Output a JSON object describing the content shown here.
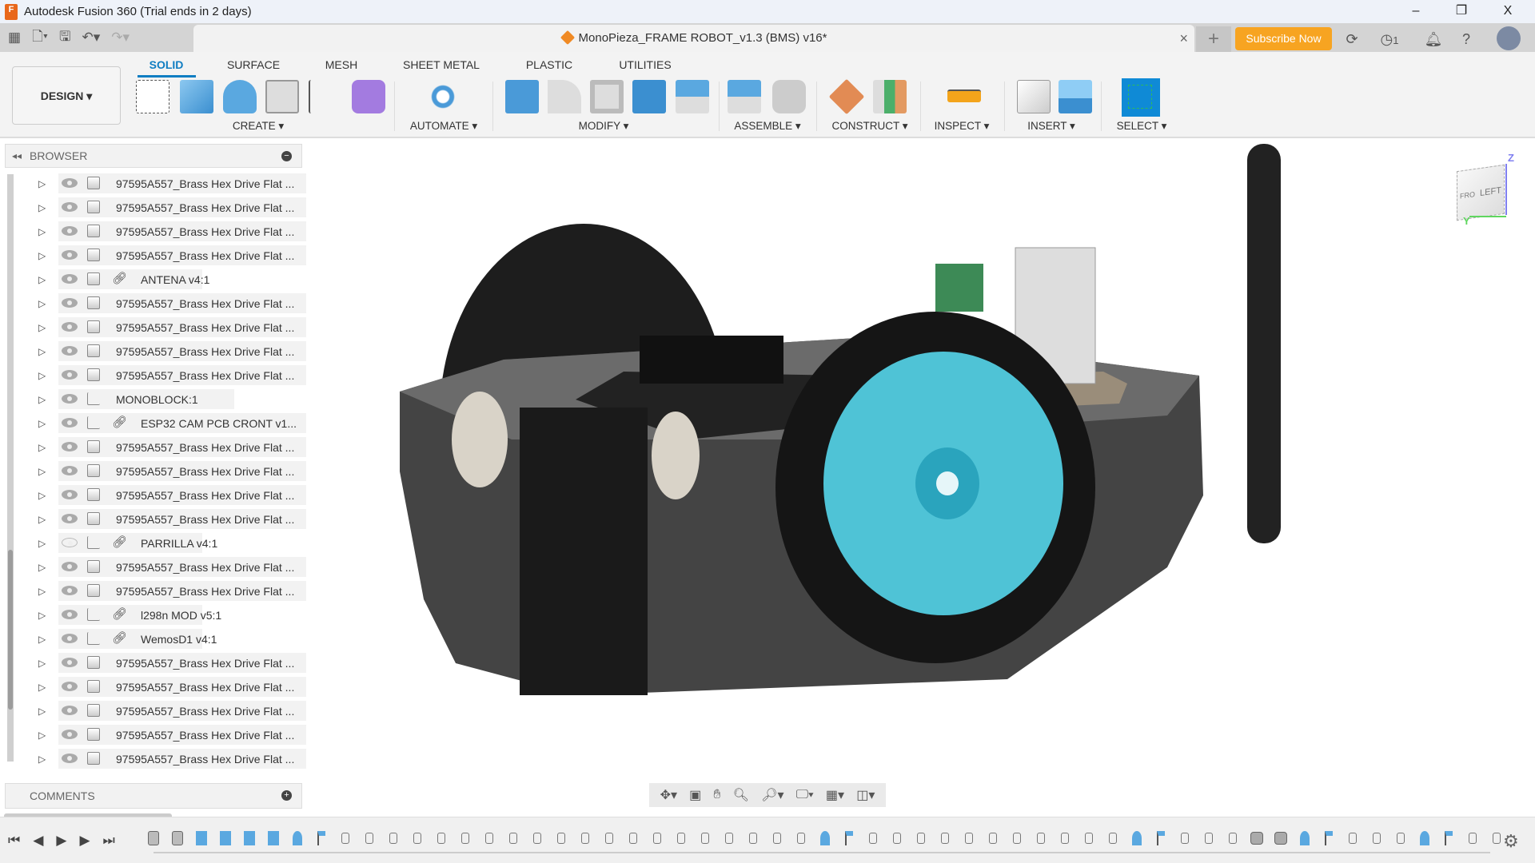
{
  "app": {
    "title": "Autodesk Fusion 360 (Trial ends in 2 days)",
    "icon": "fusion-logo-icon"
  },
  "window": {
    "minimize": "–",
    "restore": "❐",
    "close": "X"
  },
  "document": {
    "title": "MonoPieza_FRAME ROBOT_v1.3 (BMS) v16*",
    "close": "×",
    "new_tab": "+"
  },
  "header": {
    "subscribe": "Subscribe Now",
    "jobs_count": "1"
  },
  "workspace": {
    "label": "DESIGN ▾"
  },
  "tabs": [
    {
      "label": "SOLID"
    },
    {
      "label": "SURFACE"
    },
    {
      "label": "MESH"
    },
    {
      "label": "SHEET METAL"
    },
    {
      "label": "PLASTIC"
    },
    {
      "label": "UTILITIES"
    }
  ],
  "groups": {
    "create": "CREATE ▾",
    "automate": "AUTOMATE ▾",
    "modify": "MODIFY ▾",
    "assemble": "ASSEMBLE ▾",
    "construct": "CONSTRUCT ▾",
    "inspect": "INSPECT ▾",
    "insert": "INSERT ▾",
    "select": "SELECT ▾"
  },
  "colors": {
    "accent": "#0f7dc2",
    "subscribe": "#f7a421",
    "model_wheel": "#4fc3d6"
  },
  "browser": {
    "title": "BROWSER",
    "items": [
      {
        "label": "97595A557_Brass Hex Drive Flat ...",
        "type": "body",
        "visible": true,
        "link": false
      },
      {
        "label": "97595A557_Brass Hex Drive Flat ...",
        "type": "body",
        "visible": true,
        "link": false
      },
      {
        "label": "97595A557_Brass Hex Drive Flat ...",
        "type": "body",
        "visible": true,
        "link": false
      },
      {
        "label": "97595A557_Brass Hex Drive Flat ...",
        "type": "body",
        "visible": true,
        "link": false
      },
      {
        "label": "ANTENA v4:1",
        "type": "body",
        "visible": true,
        "link": true
      },
      {
        "label": "97595A557_Brass Hex Drive Flat ...",
        "type": "body",
        "visible": true,
        "link": false
      },
      {
        "label": "97595A557_Brass Hex Drive Flat ...",
        "type": "body",
        "visible": true,
        "link": false
      },
      {
        "label": "97595A557_Brass Hex Drive Flat ...",
        "type": "body",
        "visible": true,
        "link": false
      },
      {
        "label": "97595A557_Brass Hex Drive Flat ...",
        "type": "body",
        "visible": true,
        "link": false
      },
      {
        "label": "MONOBLOCK:1",
        "type": "assembly",
        "visible": true,
        "link": false
      },
      {
        "label": "ESP32 CAM PCB CRONT v1...",
        "type": "assembly",
        "visible": true,
        "link": true
      },
      {
        "label": "97595A557_Brass Hex Drive Flat ...",
        "type": "body",
        "visible": true,
        "link": false
      },
      {
        "label": "97595A557_Brass Hex Drive Flat ...",
        "type": "body",
        "visible": true,
        "link": false
      },
      {
        "label": "97595A557_Brass Hex Drive Flat ...",
        "type": "body",
        "visible": true,
        "link": false
      },
      {
        "label": "97595A557_Brass Hex Drive Flat ...",
        "type": "body",
        "visible": true,
        "link": false
      },
      {
        "label": "PARRILLA v4:1",
        "type": "assembly",
        "visible": false,
        "link": true
      },
      {
        "label": "97595A557_Brass Hex Drive Flat ...",
        "type": "body",
        "visible": true,
        "link": false
      },
      {
        "label": "97595A557_Brass Hex Drive Flat ...",
        "type": "body",
        "visible": true,
        "link": false
      },
      {
        "label": "l298n MOD v5:1",
        "type": "assembly",
        "visible": true,
        "link": true
      },
      {
        "label": "WemosD1 v4:1",
        "type": "assembly",
        "visible": true,
        "link": true
      },
      {
        "label": "97595A557_Brass Hex Drive Flat ...",
        "type": "body",
        "visible": true,
        "link": false
      },
      {
        "label": "97595A557_Brass Hex Drive Flat ...",
        "type": "body",
        "visible": true,
        "link": false
      },
      {
        "label": "97595A557_Brass Hex Drive Flat ...",
        "type": "body",
        "visible": true,
        "link": false
      },
      {
        "label": "97595A557_Brass Hex Drive Flat ...",
        "type": "body",
        "visible": true,
        "link": false
      },
      {
        "label": "97595A557_Brass Hex Drive Flat ...",
        "type": "body",
        "visible": true,
        "link": false
      }
    ]
  },
  "comments": {
    "title": "COMMENTS"
  },
  "viewcube": {
    "face_left": "LEFT",
    "face_front": "FRO",
    "axis_z": "Z",
    "axis_y": "Y"
  },
  "timeline": {
    "features": [
      "body",
      "body",
      "extrude",
      "extrude",
      "extrude",
      "extrude",
      "joint",
      "sketch",
      "move",
      "move",
      "move",
      "move",
      "move",
      "move",
      "move",
      "move",
      "move",
      "move",
      "move",
      "move",
      "move",
      "move",
      "move",
      "move",
      "move",
      "move",
      "move",
      "move",
      "joint",
      "sketch",
      "move",
      "move",
      "move",
      "move",
      "move",
      "move",
      "move",
      "move",
      "move",
      "move",
      "move",
      "joint",
      "sketch",
      "move",
      "move",
      "move",
      "split",
      "split",
      "joint",
      "sketch",
      "move",
      "move",
      "move",
      "joint",
      "sketch",
      "move",
      "move"
    ]
  }
}
